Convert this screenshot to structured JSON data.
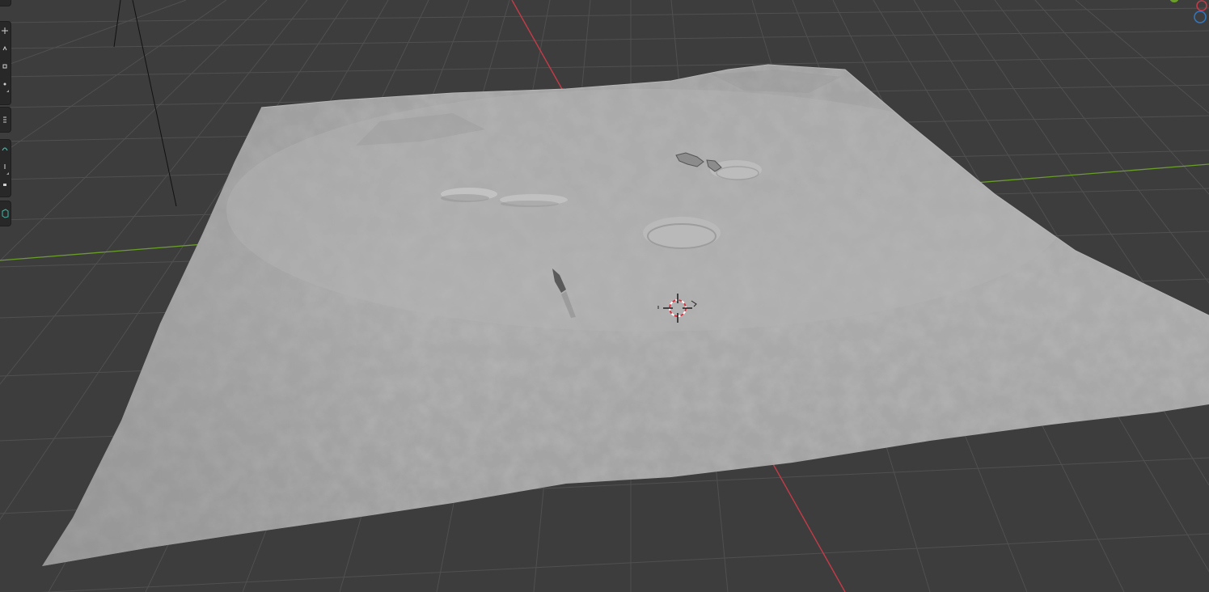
{
  "app": {
    "name": "3D Viewport"
  },
  "viewport": {
    "background": "#3d3d3d",
    "grid_color": "#4f4f4f",
    "x_axis_color": "#c63b48",
    "y_axis_color": "#6a9d2a",
    "terrain_color": "#a9a9a9"
  },
  "toolbar": {
    "tools": [
      {
        "name": "cursor-tool",
        "icon": "cursor-icon",
        "active": false
      },
      {
        "name": "move-tool",
        "icon": "move-icon",
        "active": false
      },
      {
        "name": "rotate-tool",
        "icon": "rotate-icon",
        "active": false
      },
      {
        "name": "scale-tool",
        "icon": "scale-icon",
        "active": false
      },
      {
        "name": "transform-tool",
        "icon": "transform-icon",
        "active": false
      },
      {
        "name": "annotate-tool",
        "icon": "annotate-icon",
        "active": false
      },
      {
        "name": "measure-tool",
        "icon": "measure-icon",
        "active": false
      },
      {
        "name": "add-cube-tool",
        "icon": "add-cube-icon",
        "active": false
      }
    ]
  },
  "gizmo": {
    "y_color": "#6a9d2a",
    "x_color": "#c63b48",
    "z_color": "#2f78c2"
  },
  "scene": {
    "objects": [
      "terrain-plane",
      "3d-cursor",
      "camera"
    ]
  }
}
